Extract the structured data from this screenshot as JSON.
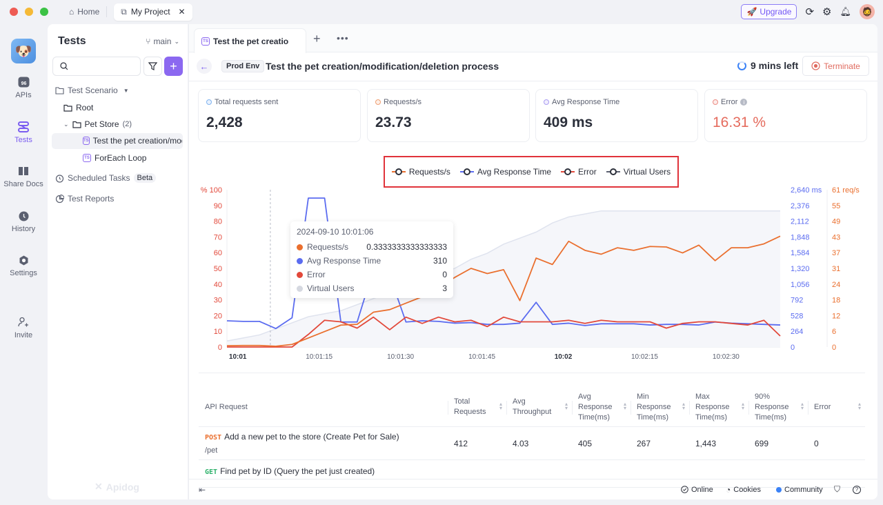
{
  "titlebar": {
    "home_label": "Home",
    "project_tab": "My Project",
    "upgrade_label": "Upgrade",
    "colors": {
      "close": "#ee5b54",
      "min": "#f5b936",
      "max": "#3cc245",
      "accent": "#7357f5"
    }
  },
  "rail": {
    "items": [
      {
        "label": "APIs",
        "icon": "api-icon"
      },
      {
        "label": "Tests",
        "icon": "tests-icon",
        "active": true
      },
      {
        "label": "Share Docs",
        "icon": "book-icon"
      },
      {
        "label": "History",
        "icon": "clock-icon"
      },
      {
        "label": "Settings",
        "icon": "settings-icon"
      },
      {
        "label": "Invite",
        "icon": "invite-icon"
      }
    ]
  },
  "panel": {
    "title": "Tests",
    "branch": "main",
    "search_placeholder": "",
    "tree": {
      "scenario": "Test Scenario",
      "root": "Root",
      "folder": "Pet Store",
      "folder_count": "(2)",
      "items": [
        "Test the pet creation/modification/deletion process",
        "ForEach Loop"
      ],
      "scheduled": "Scheduled Tasks",
      "beta": "Beta",
      "reports": "Test Reports"
    },
    "watermark": "Apidog"
  },
  "main": {
    "tab_label": "Test the pet creation/modification/deletion process",
    "env": "Prod Env",
    "title": "Test the pet creation/modification/deletion process",
    "time_left": "9 mins left",
    "terminate": "Terminate",
    "stats": [
      {
        "label": "Total requests sent",
        "value": "2,428",
        "color": "#7fb3f0"
      },
      {
        "label": "Requests/s",
        "value": "23.73",
        "color": "#f0a074"
      },
      {
        "label": "Avg Response Time",
        "value": "409 ms",
        "color": "#a99cf2"
      },
      {
        "label": "Error",
        "value": "16.31 %",
        "color": "#ec8c84",
        "value_color": "#e56b5d"
      }
    ]
  },
  "chart_data": {
    "type": "line",
    "legend": [
      "Requests/s",
      "Avg Response Time",
      "Error",
      "Virtual Users"
    ],
    "legend_placement": "top-center",
    "colors": {
      "Requests/s": "#ea6f2e",
      "Avg Response Time": "#5b6cf0",
      "Error": "#e2483a",
      "Virtual Users": "#5b6070",
      "vu_area": "#f5f6fa",
      "vu_line": "#dfe3ee"
    },
    "x_ticks": [
      "10:01",
      "10:01:15",
      "10:01:30",
      "10:01:45",
      "10:02",
      "10:02:15",
      "10:02:30"
    ],
    "x_tick_seconds": [
      60,
      75,
      90,
      105,
      120,
      135,
      150
    ],
    "x_seconds": [
      58,
      61,
      64,
      67,
      70,
      73,
      76,
      79,
      82,
      85,
      88,
      91,
      94,
      97,
      100,
      103,
      106,
      109,
      112,
      115,
      118,
      121,
      124,
      127,
      130,
      133,
      136,
      139,
      142,
      145,
      148,
      151,
      154,
      157,
      160
    ],
    "x_range": [
      58,
      160
    ],
    "y_left": {
      "label": "%",
      "ticks": [
        0,
        10,
        20,
        30,
        40,
        50,
        60,
        70,
        80,
        90,
        100
      ],
      "range": [
        0,
        100
      ],
      "top_label": "% 100"
    },
    "y_right_ms": {
      "ticks": [
        "0",
        "264",
        "528",
        "792",
        "1,056",
        "1,320",
        "1,584",
        "1,848",
        "2,112",
        "2,376",
        "2,640 ms"
      ],
      "range": [
        0,
        2640
      ]
    },
    "y_right_rps": {
      "ticks": [
        "0",
        "6",
        "12",
        "18",
        "24",
        "31",
        "37",
        "43",
        "49",
        "55",
        "61 req/s"
      ],
      "range": [
        0,
        61
      ]
    },
    "series": [
      {
        "name": "Requests/s",
        "axis": "rps",
        "values": [
          0.5,
          0.6,
          0.6,
          0.3,
          1.0,
          3.5,
          6.0,
          8.5,
          8.8,
          13.5,
          14.5,
          17.0,
          19.5,
          23.0,
          27.0,
          30.5,
          28.5,
          30.0,
          18.0,
          34.5,
          32.0,
          41.0,
          37.5,
          36.0,
          38.5,
          37.5,
          39.0,
          38.8,
          36.5,
          39.5,
          33.5,
          38.5,
          38.5,
          40.0,
          43.0
        ]
      },
      {
        "name": "Avg Response Time",
        "axis": "ms",
        "values": [
          440,
          430,
          430,
          310,
          490,
          2500,
          2500,
          420,
          420,
          1300,
          1200,
          420,
          440,
          430,
          400,
          410,
          380,
          380,
          400,
          750,
          380,
          400,
          360,
          390,
          390,
          390,
          370,
          380,
          380,
          370,
          420,
          400,
          390,
          380,
          370
        ]
      },
      {
        "name": "Error",
        "axis": "pct",
        "values": [
          0,
          0,
          0,
          0,
          0,
          8,
          17,
          16,
          12,
          19,
          11,
          19,
          15,
          19,
          16,
          17,
          13,
          19,
          16,
          16,
          16,
          17,
          15,
          17,
          16,
          16,
          16,
          12,
          15,
          16,
          16,
          15,
          14,
          17,
          7
        ]
      },
      {
        "name": "Virtual Users",
        "axis": "vu",
        "values": [
          1,
          1.5,
          2,
          3,
          4,
          5,
          5.5,
          6,
          7,
          8,
          9,
          10,
          11,
          12,
          13,
          14.5,
          15.5,
          17,
          18,
          19,
          20.5,
          21.5,
          22,
          22.5,
          22.5,
          22.5,
          22.5,
          22.5,
          22.5,
          22.5,
          22.5,
          22.5,
          22.5,
          22.5,
          22.5
        ],
        "range": [
          0,
          26
        ]
      }
    ],
    "hover_x_seconds": 66,
    "tooltip": {
      "title": "2024-09-10 10:01:06",
      "rows": [
        {
          "label": "Requests/s",
          "value": "0.3333333333333333",
          "color": "#ea6f2e"
        },
        {
          "label": "Avg Response Time",
          "value": "310",
          "color": "#5b6cf0"
        },
        {
          "label": "Error",
          "value": "0",
          "color": "#e2483a"
        },
        {
          "label": "Virtual Users",
          "value": "3",
          "color": "#d5d8e0"
        }
      ]
    }
  },
  "table": {
    "headers": [
      "API Request",
      "Total Requests",
      "Avg Throughput",
      "Avg Response Time(ms)",
      "Min Response Time(ms)",
      "Max Response Time(ms)",
      "90% Response Time(ms)",
      "Error"
    ],
    "rows": [
      {
        "method": "POST",
        "method_color": "#ea6f2e",
        "name": "Add a new pet to the store (Create Pet for Sale)",
        "path": "/pet",
        "cells": [
          "412",
          "4.03",
          "405",
          "267",
          "1,443",
          "699",
          "0"
        ]
      },
      {
        "method": "GET",
        "method_color": "#2fb26c",
        "name": "Find pet by ID (Query the pet just created)",
        "path": "",
        "cells": [
          "",
          "",
          "",
          "",
          "",
          "",
          ""
        ]
      }
    ]
  },
  "footer": {
    "online": "Online",
    "cookies": "Cookies",
    "community": "Community"
  }
}
